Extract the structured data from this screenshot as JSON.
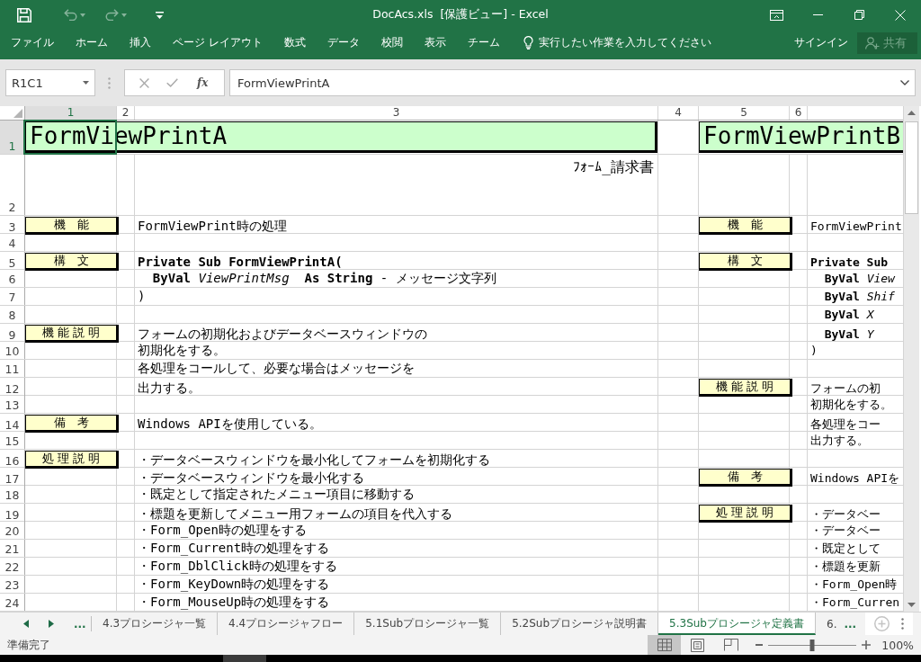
{
  "window": {
    "title": "DocAcs.xls  [保護ビュー] - Excel"
  },
  "quick_access": [
    {
      "kind": "save",
      "disabled": false
    },
    {
      "kind": "undo",
      "disabled": true
    },
    {
      "kind": "redo",
      "disabled": true
    },
    {
      "kind": "customize",
      "disabled": false
    }
  ],
  "window_controls": [
    {
      "kind": "ribbon-options"
    },
    {
      "kind": "minimize"
    },
    {
      "kind": "restore"
    },
    {
      "kind": "close"
    }
  ],
  "ribbon": {
    "tabs": [
      {
        "label": "ファイル",
        "selected": false
      },
      {
        "label": "ホーム",
        "selected": false
      },
      {
        "label": "挿入",
        "selected": false
      },
      {
        "label": "ページ レイアウト",
        "selected": false
      },
      {
        "label": "数式",
        "selected": false
      },
      {
        "label": "データ",
        "selected": false
      },
      {
        "label": "校閲",
        "selected": false
      },
      {
        "label": "表示",
        "selected": false
      },
      {
        "label": "チーム",
        "selected": false
      }
    ],
    "tell_me": "実行したい作業を入力してください",
    "sign_in": "サインイン",
    "share": {
      "label": "共有",
      "disabled": true
    }
  },
  "formula_bar": {
    "name_box": "R1C1",
    "function_button": "fx",
    "value": "FormViewPrintA"
  },
  "sheet": {
    "columns": [
      {
        "label": "1",
        "selected": true
      },
      {
        "label": "2",
        "selected": false
      },
      {
        "label": "3",
        "selected": false
      },
      {
        "label": "4",
        "selected": false
      },
      {
        "label": "5",
        "selected": false
      },
      {
        "label": "6",
        "selected": false
      }
    ],
    "rows": [
      {
        "number": "1",
        "selected": true,
        "kind": "title",
        "left": {
          "title": "FormViewPrintA"
        },
        "right": {
          "title": "FormViewPrintB"
        }
      },
      {
        "number": "2",
        "selected": false,
        "kind": "note",
        "left": {
          "note": "ﾌｫｰﾑ_請求書"
        }
      },
      {
        "number": "3",
        "selected": false,
        "kind": "body",
        "left": {
          "label": "機　能",
          "text": "FormViewPrint時の処理"
        },
        "right": {
          "label": "機　能",
          "text": "FormViewPrint"
        }
      },
      {
        "number": "4",
        "selected": false,
        "kind": "body"
      },
      {
        "number": "5",
        "selected": false,
        "kind": "body",
        "left": {
          "label": "構　文",
          "text": "Private Sub FormViewPrintA(",
          "bold": true
        },
        "right": {
          "label": "構　文",
          "text": "Private Sub",
          "bold": true
        }
      },
      {
        "number": "6",
        "selected": false,
        "kind": "body",
        "left": {
          "text": "  **ByVal** *ViewPrintMsg*  **As String** - メッセージ文字列"
        },
        "right": {
          "text": "  **ByVal** *View*"
        }
      },
      {
        "number": "7",
        "selected": false,
        "kind": "body",
        "left": {
          "text": ")"
        },
        "right": {
          "text": "  **ByVal** *Shif*"
        }
      },
      {
        "number": "8",
        "selected": false,
        "kind": "body",
        "right": {
          "text": "  **ByVal** *X*"
        }
      },
      {
        "number": "9",
        "selected": false,
        "kind": "body",
        "left": {
          "label": "機 能 説 明",
          "text": "フォームの初期化およびデータベースウィンドウの"
        },
        "right": {
          "text": "  **ByVal** *Y*"
        }
      },
      {
        "number": "10",
        "selected": false,
        "kind": "body",
        "left": {
          "text": "初期化をする。"
        },
        "right": {
          "text": ")"
        }
      },
      {
        "number": "11",
        "selected": false,
        "kind": "body",
        "left": {
          "text": "各処理をコールして、必要な場合はメッセージを"
        }
      },
      {
        "number": "12",
        "selected": false,
        "kind": "body",
        "left": {
          "text": "出力する。"
        },
        "right": {
          "label": "機 能 説 明",
          "text": "フォームの初"
        }
      },
      {
        "number": "13",
        "selected": false,
        "kind": "body",
        "right": {
          "text": "初期化をする。"
        }
      },
      {
        "number": "14",
        "selected": false,
        "kind": "body",
        "left": {
          "label": "備　考",
          "text": "Windows APIを使用している。"
        },
        "right": {
          "text": "各処理をコー"
        }
      },
      {
        "number": "15",
        "selected": false,
        "kind": "body",
        "right": {
          "text": "出力する。"
        }
      },
      {
        "number": "16",
        "selected": false,
        "kind": "body",
        "left": {
          "label": "処 理 説 明",
          "text": "・データベースウィンドウを最小化してフォームを初期化する"
        }
      },
      {
        "number": "17",
        "selected": false,
        "kind": "body",
        "left": {
          "text": "・データベースウィンドウを最小化する"
        },
        "right": {
          "label": "備　考",
          "text": "Windows APIを"
        }
      },
      {
        "number": "18",
        "selected": false,
        "kind": "body",
        "left": {
          "text": "・既定として指定されたメニュー項目に移動する"
        }
      },
      {
        "number": "19",
        "selected": false,
        "kind": "body",
        "left": {
          "text": "・標題を更新してメニュー用フォームの項目を代入する"
        },
        "right": {
          "label": "処 理 説 明",
          "text": "・データベー"
        }
      },
      {
        "number": "20",
        "selected": false,
        "kind": "body",
        "left": {
          "text": "・Form_Open時の処理をする"
        },
        "right": {
          "text": "・データベー"
        }
      },
      {
        "number": "21",
        "selected": false,
        "kind": "body",
        "left": {
          "text": "・Form_Current時の処理をする"
        },
        "right": {
          "text": "・既定として"
        }
      },
      {
        "number": "22",
        "selected": false,
        "kind": "body",
        "left": {
          "text": "・Form_DblClick時の処理をする"
        },
        "right": {
          "text": "・標題を更新"
        }
      },
      {
        "number": "23",
        "selected": false,
        "kind": "body",
        "left": {
          "text": "・Form_KeyDown時の処理をする"
        },
        "right": {
          "text": "・Form_Open時"
        }
      },
      {
        "number": "24",
        "selected": false,
        "kind": "body",
        "left": {
          "text": "・Form_MouseUp時の処理をする"
        },
        "right": {
          "text": "・Form_Curren"
        }
      }
    ]
  },
  "sheet_tabs": {
    "left_more": "...",
    "tabs": [
      {
        "label": "4.3プロシージャ一覧",
        "selected": false
      },
      {
        "label": "4.4プロシージャフロー",
        "selected": false
      },
      {
        "label": "5.1Subプロシージャ一覧",
        "selected": false
      },
      {
        "label": "5.2Subプロシージャ説明書",
        "selected": false
      },
      {
        "label": "5.3Subプロシージャ定義書",
        "selected": true
      },
      {
        "label": "6.",
        "selected": false
      }
    ],
    "right_more": "..."
  },
  "status_bar": {
    "status": "準備完了",
    "views": [
      {
        "kind": "normal",
        "selected": true
      },
      {
        "kind": "page-layout",
        "selected": false
      },
      {
        "kind": "page-break",
        "selected": false
      }
    ],
    "zoom": {
      "level": 0.5,
      "reading": "100%"
    }
  }
}
